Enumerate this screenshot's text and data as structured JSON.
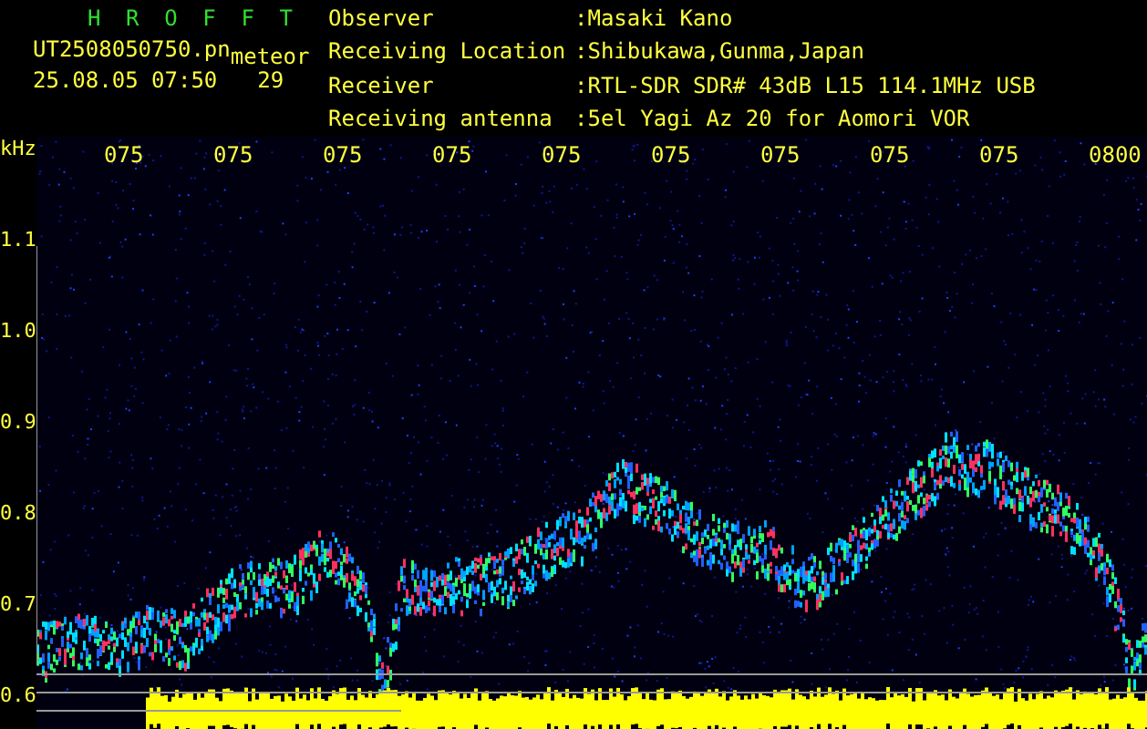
{
  "title": "H R O F F T",
  "file": "UT2508050750.pn",
  "file_suffix": "meteor",
  "timestamp": "25.08.05 07:50",
  "count": "29",
  "info": [
    {
      "label": "Observer",
      "value": ":Masaki Kano"
    },
    {
      "label": "Receiving Location",
      "value": ":Shibukawa,Gunma,Japan"
    },
    {
      "label": "Receiver",
      "value": ":RTL-SDR SDR# 43dB L15 114.1MHz USB"
    },
    {
      "label": "Receiving antenna",
      "value": ":5el Yagi Az 20 for Aomori VOR"
    }
  ],
  "y_unit": "kHz",
  "x_labels": [
    "075",
    "075",
    "075",
    "075",
    "075",
    "075",
    "075",
    "075",
    "075",
    "0800"
  ],
  "y_labels": [
    "1.1",
    "1.0",
    "0.9",
    "0.8",
    "0.7",
    "0.6"
  ]
}
